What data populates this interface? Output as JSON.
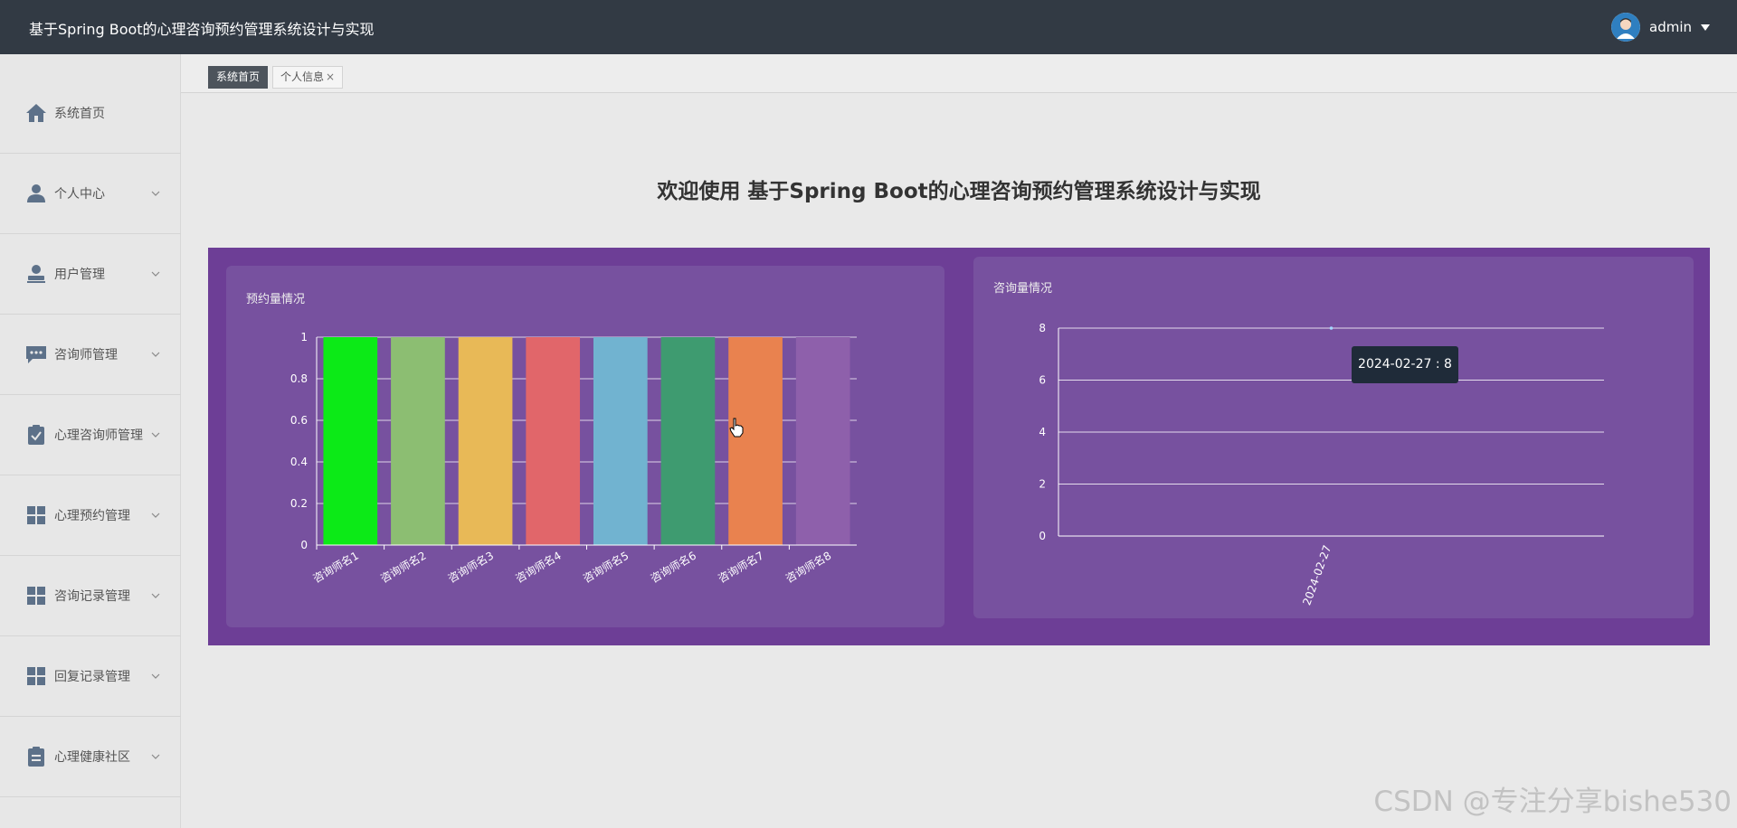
{
  "header": {
    "app_title": "基于Spring Boot的心理咨询预约管理系统设计与实现",
    "username": "admin"
  },
  "sidebar": {
    "items": [
      {
        "label": "系统首页",
        "icon": "home-icon"
      },
      {
        "label": "个人中心",
        "icon": "user-icon"
      },
      {
        "label": "用户管理",
        "icon": "user-manage-icon"
      },
      {
        "label": "咨询师管理",
        "icon": "chat-icon"
      },
      {
        "label": "心理咨询师管理",
        "icon": "clipboard-check-icon"
      },
      {
        "label": "心理预约管理",
        "icon": "grid-icon"
      },
      {
        "label": "咨询记录管理",
        "icon": "grid-icon"
      },
      {
        "label": "回复记录管理",
        "icon": "grid-icon"
      },
      {
        "label": "心理健康社区",
        "icon": "clipboard-icon"
      }
    ]
  },
  "tabs": [
    {
      "label": "系统首页",
      "active": true
    },
    {
      "label": "个人信息",
      "active": false,
      "close": "×"
    }
  ],
  "main": {
    "welcome": "欢迎使用 基于Spring Boot的心理咨询预约管理系统设计与实现"
  },
  "chart_data": [
    {
      "type": "bar",
      "title": "预约量情况",
      "categories": [
        "咨询师名1",
        "咨询师名2",
        "咨询师名3",
        "咨询师名4",
        "咨询师名5",
        "咨询师名6",
        "咨询师名7",
        "咨询师名8"
      ],
      "values": [
        1,
        1,
        1,
        1,
        1,
        1,
        1,
        1
      ],
      "colors": [
        "#0cea17",
        "#8cbe72",
        "#e8b957",
        "#e1666a",
        "#71b3d0",
        "#3e9b70",
        "#e9824f",
        "#8e60ab"
      ],
      "ylim": [
        0,
        1
      ],
      "yticks": [
        "0",
        "0.2",
        "0.4",
        "0.6",
        "0.8",
        "1"
      ],
      "grid": true
    },
    {
      "type": "line",
      "title": "咨询量情况",
      "x": [
        "2024-02-27"
      ],
      "values": [
        8
      ],
      "ylim": [
        0,
        8
      ],
      "yticks": [
        "0",
        "2",
        "4",
        "6",
        "8"
      ],
      "grid": true,
      "tooltip": "2024-02-27 : 8"
    }
  ],
  "watermark": "CSDN @专注分享bishe530",
  "colors": {
    "topbar": "#323a44",
    "panel": "#6d3e96",
    "card": "#77519f"
  }
}
